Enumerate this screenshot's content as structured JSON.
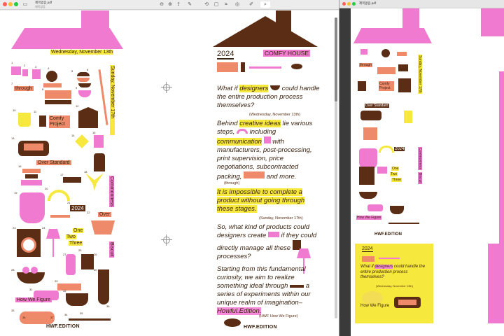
{
  "window1": {
    "filename": "제목없음.pdf",
    "subtitle": "제목없음",
    "toolbar": {
      "sidebar_icon": "sidebar-icon",
      "zoom_out_icon": "zoom-out-icon",
      "zoom_in_icon": "zoom-in-icon",
      "share_icon": "share-icon",
      "pen_icon": "pen-icon",
      "rotate_icon": "rotate-icon",
      "markup_icon": "markup-icon",
      "crop_icon": "crop-icon",
      "circle_icon": "circle-icon",
      "highlight_icon": "highlight-icon",
      "search_icon": "search-icon"
    }
  },
  "window2": {
    "filename": "제목없음.pdf"
  },
  "page1": {
    "date_start": "Wednesday, November 13th",
    "date_end": "Sunday, November 17th",
    "through": "through",
    "comfy_project": "Comfy Project",
    "over_standard": "Over Standard",
    "year": "2024",
    "commonness": "Commonness",
    "over": "Over",
    "one": "One",
    "two": "Two",
    "three": "Three",
    "biscuit": "Biscuit",
    "how_we_figure": "How We Figure",
    "logo": "HWF.EDITION",
    "nums": [
      "1",
      "2",
      "3",
      "4",
      "5",
      "6",
      "7",
      "8",
      "9",
      "10",
      "11",
      "12",
      "13",
      "14",
      "15",
      "16",
      "17",
      "18",
      "19",
      "20",
      "21",
      "22",
      "23",
      "24",
      "25",
      "26",
      "27",
      "28",
      "29",
      "30",
      "31",
      "32",
      "33",
      "34",
      "35",
      "36",
      "37",
      "38"
    ]
  },
  "page2": {
    "year": "2024",
    "title": "COMFY HOUSE",
    "p1a": "What if",
    "p1hl": "designers",
    "p1b": "could handle the entire production process themselves?",
    "p1date": "(Wednesday, November 13th)",
    "p2a": "Behind",
    "p2hl": "creative ideas",
    "p2b": "lie various steps,",
    "p2c": "including",
    "p2hl2": "communication",
    "p2d": "with manufacturers, post-processing, print supervision, price negotiations, subcontracted packing,",
    "p2e": "and more.",
    "through": "(through)",
    "p3": "It is impossible to complete a product without going through these stages.",
    "p3date": "(Sunday, November 17th)",
    "p4": "So, what kind of products could designers create",
    "p4b": "if they could directly manage all these",
    "p4c": "processes?",
    "p5": "Starting from this fundamental curiosity, we aim to realize something ideal through",
    "p5b": "a series of experiments",
    "p5c": "within our unique realm of imagination–",
    "p5hl": "Howful.Edition.",
    "sig": "(HWF How We Figure)",
    "logo": "HWF.EDITION"
  },
  "page3": {
    "date_start": "Wednesday, November 13th",
    "date_end": "Sunday, November 17th",
    "through": "through",
    "comfy_project": "Comfy Project",
    "over_standard": "Over Standard",
    "year": "2024",
    "commonness": "Commonness",
    "one": "One",
    "two": "Two",
    "three": "Three",
    "biscuit": "Biscuit",
    "how_we_figure": "How We Figure",
    "logo": "HWF.EDITION"
  },
  "page4": {
    "year": "2024",
    "p1a": "What if",
    "p1hl": "designers",
    "p1b": "could handle the entire production process themselves?",
    "p1date": "(Wednesday, November 13th)",
    "how_we_figure": "How We Figure"
  },
  "colors": {
    "pink": "#f07ad0",
    "yellow": "#f6e83c",
    "brown": "#5a2d14",
    "orange": "#ee8a6a"
  }
}
